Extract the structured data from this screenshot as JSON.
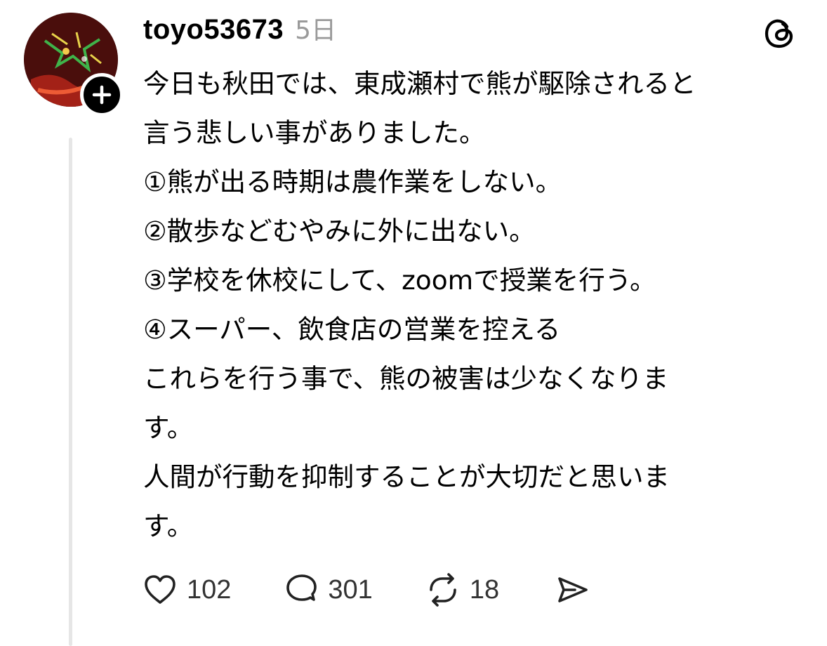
{
  "post": {
    "username": "toyo53673",
    "timestamp": "5日",
    "lines": [
      "今日も秋田では、東成瀬村で熊が駆除されると",
      "言う悲しい事がありました。",
      "①熊が出る時期は農作業をしない。",
      "②散歩などむやみに外に出ない。",
      "③学校を休校にして、zoomで授業を行う。",
      "④スーパー、飲食店の営業を控える",
      "これらを行う事で、熊の被害は少なくなりま",
      "す。",
      "人間が行動を抑制することが大切だと思いま",
      "す。"
    ]
  },
  "actions": {
    "like_count": "102",
    "reply_count": "301",
    "repost_count": "18"
  },
  "icons": {
    "follow": "plus-icon",
    "brand": "threads-logo-icon",
    "like": "heart-icon",
    "reply": "comment-bubble-icon",
    "repost": "repost-icon",
    "share": "send-icon"
  },
  "colors": {
    "text": "#000000",
    "muted": "#9a9a9a",
    "thread_line": "#e6e6e6"
  }
}
